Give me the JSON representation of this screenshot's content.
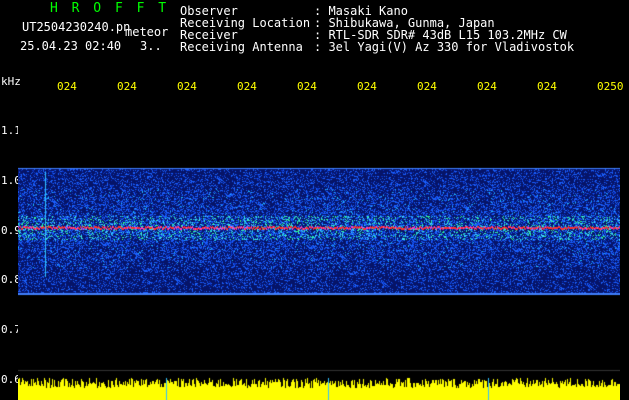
{
  "header": {
    "title": "H R O F F T",
    "filename": "UT2504230240.pn",
    "suffix": "meteor",
    "datetime": "25.04.23 02:40",
    "counter": "3.."
  },
  "info": {
    "labels": [
      "Observer",
      "Receiving Location",
      "Receiver",
      "Receiving Antenna"
    ],
    "values": [
      ": Masaki Kano",
      ": Shibukawa, Gunma, Japan",
      ": RTL-SDR SDR# 43dB L15 103.2MHz CW",
      ": 3el Yagi(V) Az 330 for Vladivostok"
    ]
  },
  "y_axis": {
    "unit": "kHz",
    "ticks": [
      "1.1",
      "1.0",
      "0.9",
      "0.8",
      "0.7",
      "0.6"
    ]
  },
  "time_ticks": [
    "024",
    "024",
    "024",
    "024",
    "024",
    "024",
    "024",
    "024",
    "024",
    "0250"
  ],
  "colors": {
    "background": "#000000",
    "band": "#0a1fa0",
    "noise": "#1a60ff",
    "signal": "#ff3030",
    "edge": "#4080ff",
    "power": "#ffff00",
    "title": "#00ff00",
    "tick": "#ffff00"
  }
}
